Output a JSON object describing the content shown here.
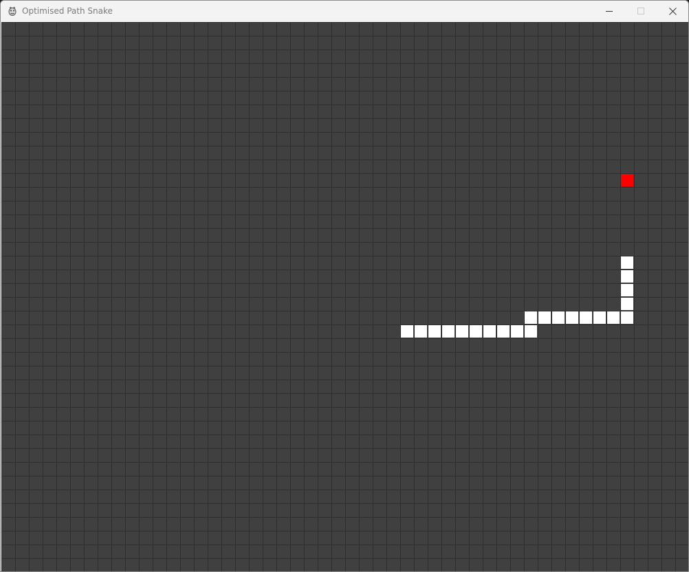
{
  "window": {
    "title": "Optimised Path Snake",
    "icon": "pygame-snake-icon",
    "controls": [
      "minimize-icon",
      "maximize-icon",
      "close-icon"
    ]
  },
  "game": {
    "grid_columns": 50,
    "grid_rows": 40,
    "colors": {
      "background": "#404040",
      "grid_line": "#2e2e2e",
      "snake": "#ffffff",
      "food": "#ff0000"
    },
    "food": {
      "col": 45,
      "row": 11
    },
    "snake": [
      {
        "col": 45,
        "row": 17
      },
      {
        "col": 45,
        "row": 18
      },
      {
        "col": 45,
        "row": 19
      },
      {
        "col": 45,
        "row": 20
      },
      {
        "col": 45,
        "row": 21
      },
      {
        "col": 44,
        "row": 21
      },
      {
        "col": 43,
        "row": 21
      },
      {
        "col": 42,
        "row": 21
      },
      {
        "col": 41,
        "row": 21
      },
      {
        "col": 40,
        "row": 21
      },
      {
        "col": 39,
        "row": 21
      },
      {
        "col": 38,
        "row": 21
      },
      {
        "col": 38,
        "row": 22
      },
      {
        "col": 37,
        "row": 22
      },
      {
        "col": 36,
        "row": 22
      },
      {
        "col": 35,
        "row": 22
      },
      {
        "col": 34,
        "row": 22
      },
      {
        "col": 33,
        "row": 22
      },
      {
        "col": 32,
        "row": 22
      },
      {
        "col": 31,
        "row": 22
      },
      {
        "col": 30,
        "row": 22
      },
      {
        "col": 29,
        "row": 22
      }
    ]
  }
}
